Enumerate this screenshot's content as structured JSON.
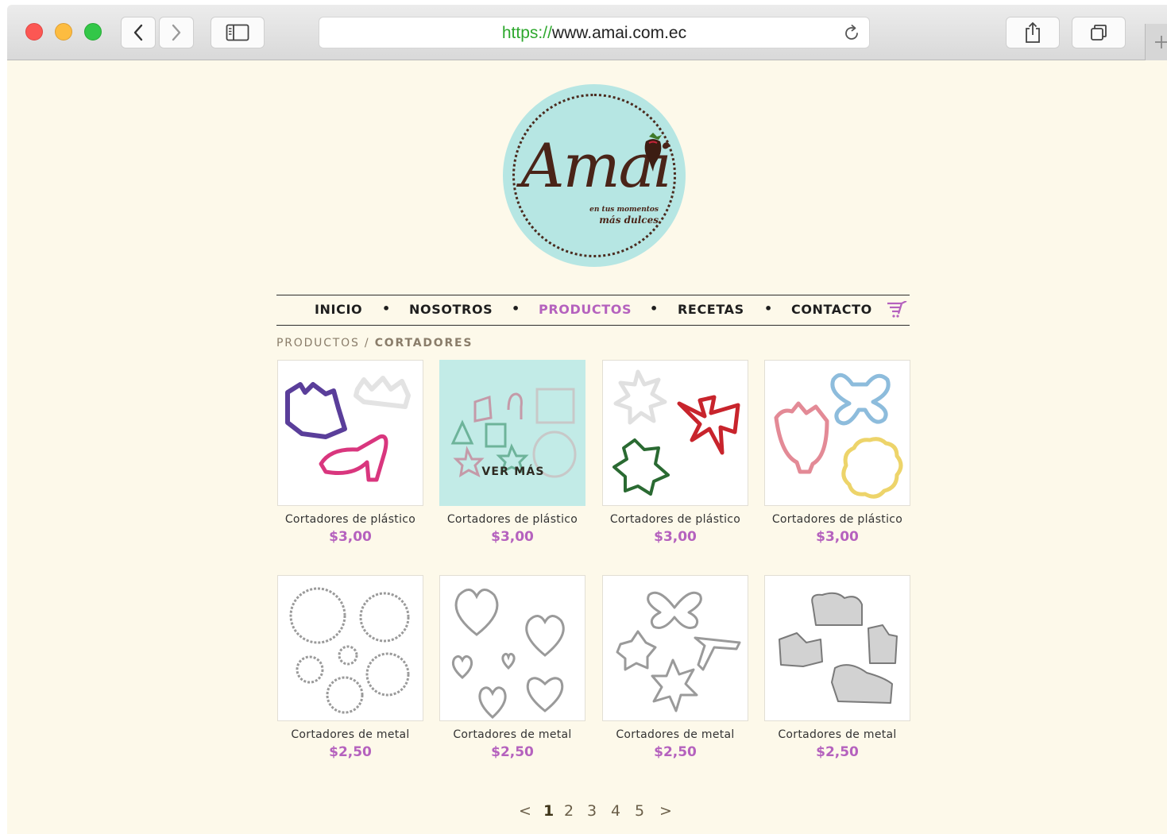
{
  "browser": {
    "url_scheme": "https://",
    "url_host": "www.amai.com.ec"
  },
  "logo": {
    "brand": "Amai",
    "tagline_line1": "en tus momentos",
    "tagline_line2": "más dulces"
  },
  "nav": {
    "items": [
      {
        "label": "INICIO",
        "active": false
      },
      {
        "label": "NOSOTROS",
        "active": false
      },
      {
        "label": "PRODUCTOS",
        "active": true
      },
      {
        "label": "RECETAS",
        "active": false
      },
      {
        "label": "CONTACTO",
        "active": false
      }
    ],
    "separator": "•",
    "cart_icon": "cart-icon"
  },
  "breadcrumb": {
    "parent": "PRODUCTOS",
    "separator": "/",
    "current": "CORTADORES"
  },
  "products": [
    {
      "name": "Cortadores de plástico",
      "price": "$3,00"
    },
    {
      "name": "Cortadores de plástico",
      "price": "$3,00",
      "overlay": "VER MÁS"
    },
    {
      "name": "Cortadores de plástico",
      "price": "$3,00"
    },
    {
      "name": "Cortadores de plástico",
      "price": "$3,00"
    },
    {
      "name": "Cortadores de metal",
      "price": "$2,50"
    },
    {
      "name": "Cortadores de metal",
      "price": "$2,50"
    },
    {
      "name": "Cortadores de metal",
      "price": "$2,50"
    },
    {
      "name": "Cortadores de metal",
      "price": "$2,50"
    }
  ],
  "pagination": {
    "prev": "<",
    "pages": [
      "1",
      "2",
      "3",
      "4",
      "5"
    ],
    "current": "1",
    "next": ">"
  },
  "colors": {
    "page_background": "#fdf9ea",
    "accent": "#b562be",
    "logo_circle": "#b6e6e3",
    "logo_brown": "#4a2418"
  }
}
